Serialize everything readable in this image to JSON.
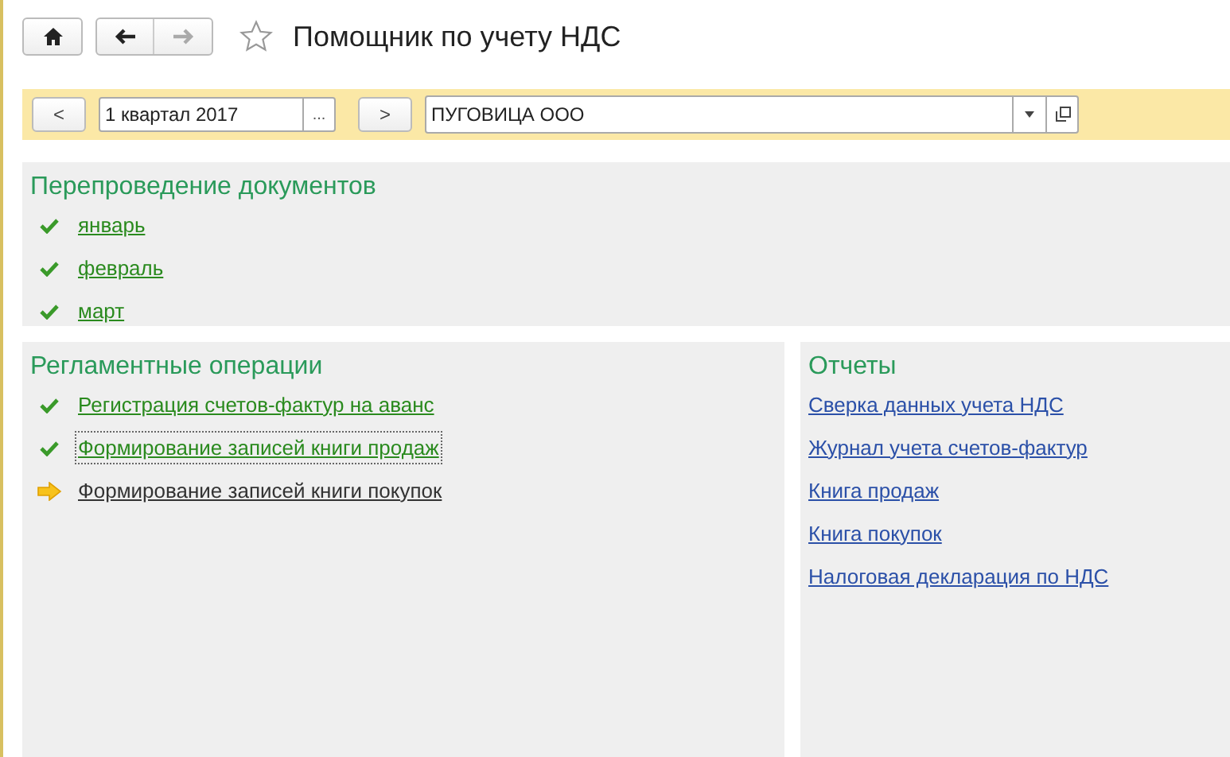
{
  "window": {
    "title": "Помощник по учету НДС"
  },
  "toolbar": {
    "prev": "<",
    "period": "1 квартал 2017",
    "period_button": "...",
    "next": ">",
    "organization": "ПУГОВИЦА ООО"
  },
  "reposting": {
    "title": "Перепроведение документов",
    "items": [
      {
        "label": "январь",
        "kind": "done"
      },
      {
        "label": "февраль",
        "kind": "done"
      },
      {
        "label": "март",
        "kind": "done"
      }
    ]
  },
  "operations": {
    "title": "Регламентные операции",
    "items": [
      {
        "label": "Регистрация счетов-фактур на аванс",
        "kind": "done",
        "focused": false
      },
      {
        "label": "Формирование записей книги продаж",
        "kind": "done",
        "focused": true
      },
      {
        "label": "Формирование записей книги покупок",
        "kind": "current",
        "focused": false
      }
    ]
  },
  "reports": {
    "title": "Отчеты",
    "items": [
      "Сверка данных учета НДС",
      "Журнал учета счетов-фактур",
      "Книга продаж",
      "Книга покупок",
      "Налоговая декларация по НДС"
    ]
  }
}
